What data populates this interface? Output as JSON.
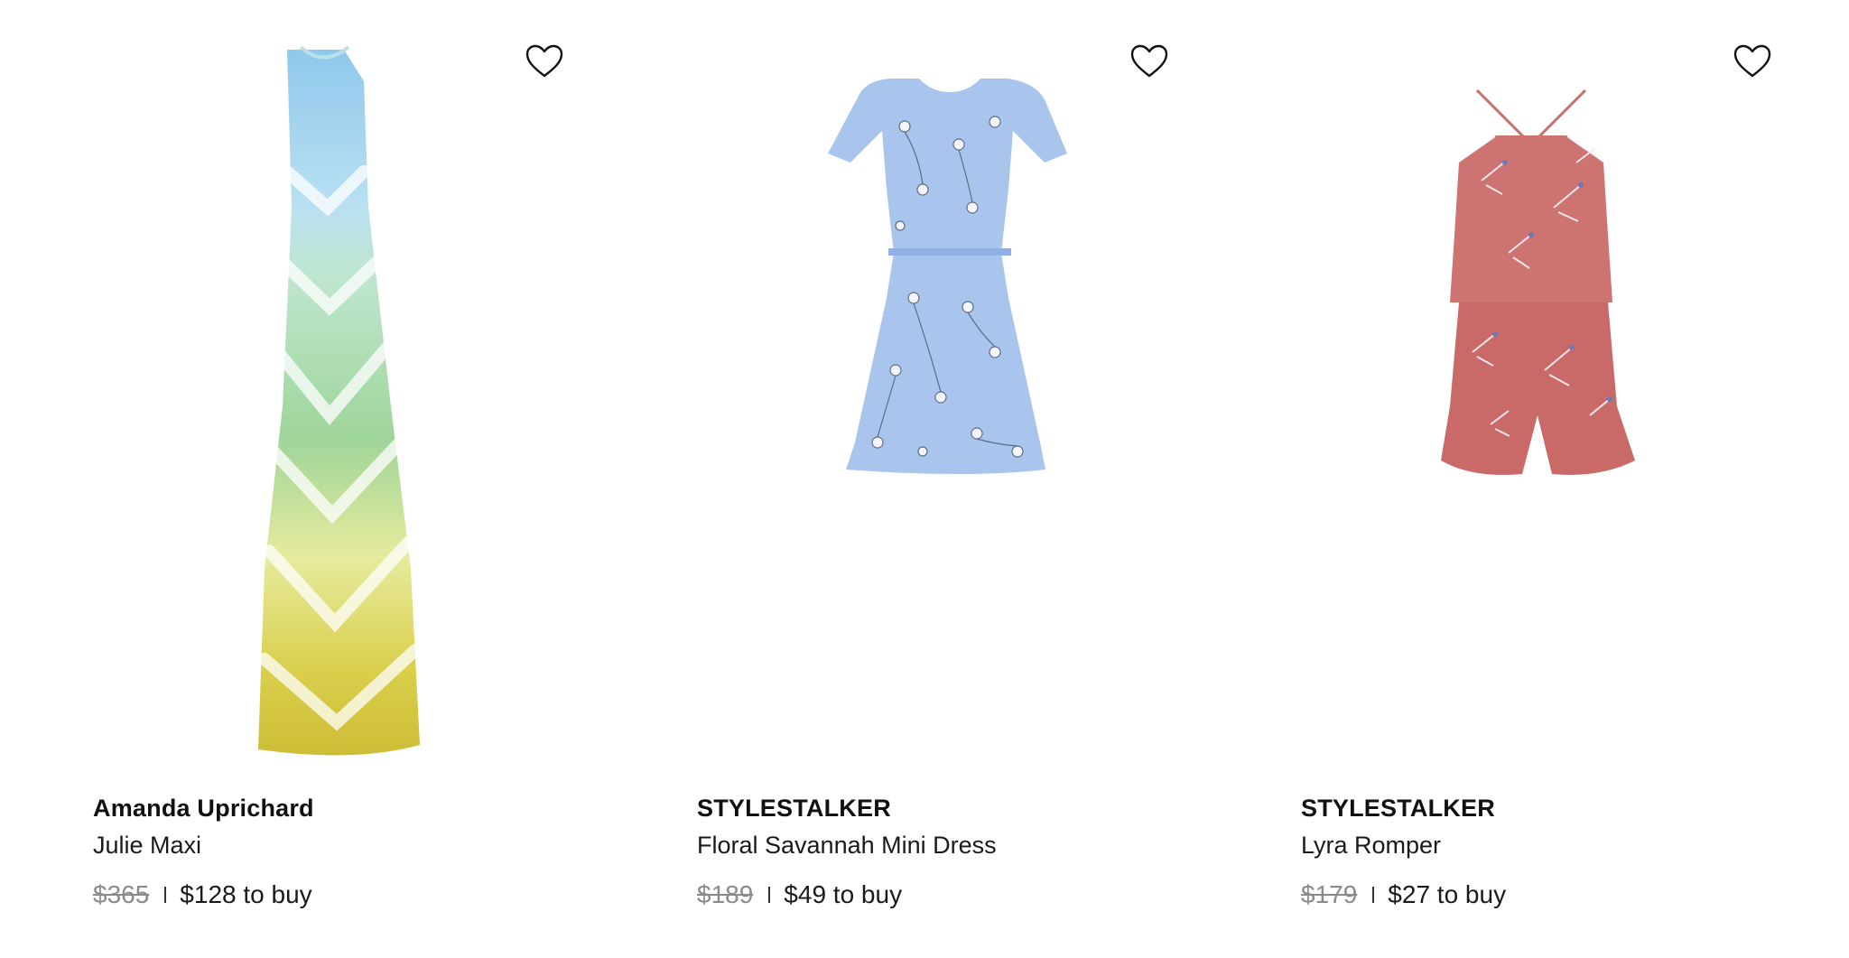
{
  "products": [
    {
      "brand": "Amanda Uprichard",
      "name": "Julie Maxi",
      "retail_price": "$365",
      "buy_price": "$128 to buy",
      "image": "tie-dye-maxi-dress"
    },
    {
      "brand": "STYLESTALKER",
      "name": "Floral Savannah Mini Dress",
      "retail_price": "$189",
      "buy_price": "$49 to buy",
      "image": "blue-floral-mini-dress"
    },
    {
      "brand": "STYLESTALKER",
      "name": "Lyra Romper",
      "retail_price": "$179",
      "buy_price": "$27 to buy",
      "image": "pink-floral-halter-romper"
    }
  ],
  "colors": {
    "text": "#111111",
    "retail_strike": "#8a8a8a",
    "heart_outline": "#111111",
    "background": "#ffffff"
  },
  "icons": {
    "favorite": "heart-outline-icon"
  }
}
